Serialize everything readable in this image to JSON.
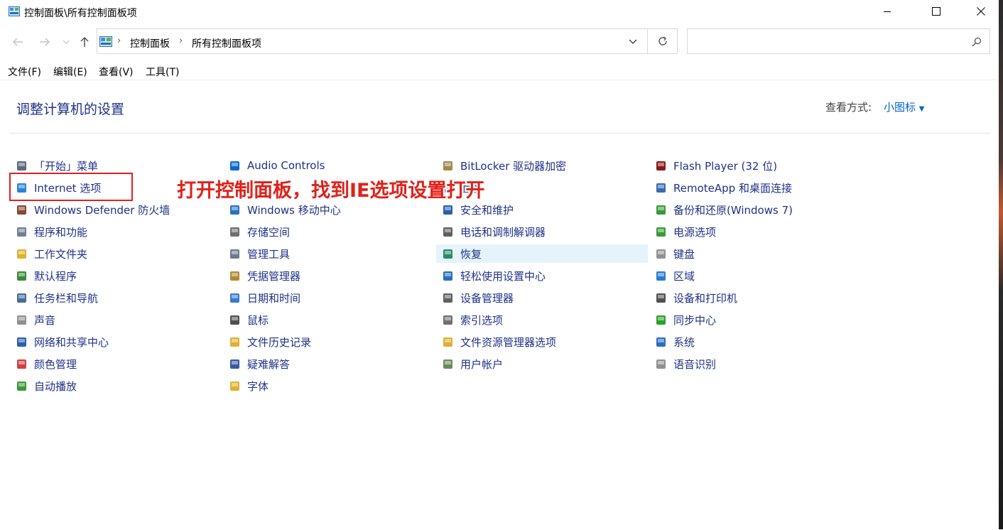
{
  "window": {
    "title": "控制面板\\所有控制面板项"
  },
  "address": {
    "crumbs": [
      "控制面板",
      "所有控制面板项"
    ],
    "search_placeholder": ""
  },
  "menu": [
    "文件(F)",
    "编辑(E)",
    "查看(V)",
    "工具(T)"
  ],
  "content": {
    "heading": "调整计算机的设置",
    "view_label": "查看方式:",
    "view_value": "小图标",
    "columns": [
      [
        {
          "label": "「开始」菜单",
          "icon": "start-menu-icon"
        },
        {
          "label": "Internet 选项",
          "icon": "internet-options-icon"
        },
        {
          "label": "Windows Defender 防火墙",
          "icon": "firewall-icon"
        },
        {
          "label": "程序和功能",
          "icon": "programs-icon"
        },
        {
          "label": "工作文件夹",
          "icon": "work-folders-icon"
        },
        {
          "label": "默认程序",
          "icon": "default-programs-icon"
        },
        {
          "label": "任务栏和导航",
          "icon": "taskbar-icon"
        },
        {
          "label": "声音",
          "icon": "sound-icon"
        },
        {
          "label": "网络和共享中心",
          "icon": "network-icon"
        },
        {
          "label": "颜色管理",
          "icon": "color-management-icon"
        },
        {
          "label": "自动播放",
          "icon": "autoplay-icon"
        }
      ],
      [
        {
          "label": "Audio Controls",
          "icon": "hp-audio-icon"
        },
        {
          "label": "",
          "icon": "nvidia-icon"
        },
        {
          "label": "Windows 移动中心",
          "icon": "mobility-center-icon"
        },
        {
          "label": "存储空间",
          "icon": "storage-spaces-icon"
        },
        {
          "label": "管理工具",
          "icon": "admin-tools-icon"
        },
        {
          "label": "凭据管理器",
          "icon": "credential-manager-icon"
        },
        {
          "label": "日期和时间",
          "icon": "date-time-icon"
        },
        {
          "label": "鼠标",
          "icon": "mouse-icon"
        },
        {
          "label": "文件历史记录",
          "icon": "file-history-icon"
        },
        {
          "label": "疑难解答",
          "icon": "troubleshooting-icon"
        },
        {
          "label": "字体",
          "icon": "fonts-icon"
        }
      ],
      [
        {
          "label": "BitLocker 驱动器加密",
          "icon": "bitlocker-icon"
        },
        {
          "label": "面板",
          "icon": "panel-icon"
        },
        {
          "label": "安全和维护",
          "icon": "security-maintenance-icon"
        },
        {
          "label": "电话和调制解调器",
          "icon": "phone-modem-icon"
        },
        {
          "label": "恢复",
          "icon": "recovery-icon"
        },
        {
          "label": "轻松使用设置中心",
          "icon": "ease-of-access-icon"
        },
        {
          "label": "设备管理器",
          "icon": "device-manager-icon"
        },
        {
          "label": "索引选项",
          "icon": "indexing-icon"
        },
        {
          "label": "文件资源管理器选项",
          "icon": "explorer-options-icon"
        },
        {
          "label": "用户帐户",
          "icon": "user-accounts-icon"
        }
      ],
      [
        {
          "label": "Flash Player (32 位)",
          "icon": "flash-player-icon"
        },
        {
          "label": "RemoteApp 和桌面连接",
          "icon": "remoteapp-icon"
        },
        {
          "label": "备份和还原(Windows 7)",
          "icon": "backup-restore-icon"
        },
        {
          "label": "电源选项",
          "icon": "power-options-icon"
        },
        {
          "label": "键盘",
          "icon": "keyboard-icon"
        },
        {
          "label": "区域",
          "icon": "region-icon"
        },
        {
          "label": "设备和打印机",
          "icon": "devices-printers-icon"
        },
        {
          "label": "同步中心",
          "icon": "sync-center-icon"
        },
        {
          "label": "系统",
          "icon": "system-icon"
        },
        {
          "label": "语音识别",
          "icon": "speech-recognition-icon"
        }
      ]
    ]
  },
  "annotation": "打开控制面板，找到IE选项设置打开",
  "colors": {
    "link": "#1e3287",
    "accent": "#0066cc",
    "annotation": "#e0211a",
    "hover": "#e5f3fb"
  }
}
